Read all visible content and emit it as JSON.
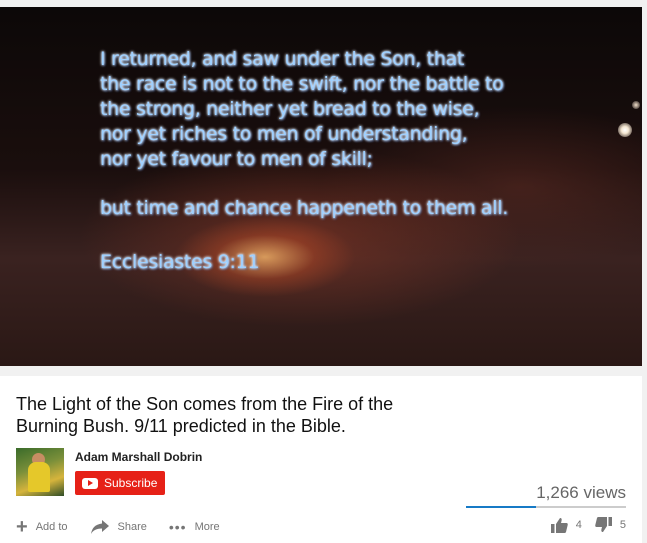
{
  "video": {
    "verse_lines": [
      "I returned, and saw under the Son, that",
      "the race is not to the swift, nor the battle to",
      "the strong, neither yet bread to the wise,",
      "nor yet riches to men of understanding,",
      "nor yet favour to men of skill;"
    ],
    "conclusion": "but time and chance happeneth to them all.",
    "reference": "Ecclesiastes 9:11"
  },
  "info": {
    "title": "The Light of the Son comes from the Fire of the Burning Bush. 9/11 predicted in the Bible.",
    "channel_name": "Adam Marshall Dobrin",
    "subscribe_label": "Subscribe",
    "views": "1,266 views",
    "like_ratio": 0.44
  },
  "actions": {
    "add_to": "Add to",
    "share": "Share",
    "more": "More",
    "like_count": "4",
    "dislike_count": "5"
  },
  "icons": [
    "plus-icon",
    "share-arrow-icon",
    "more-dots-icon",
    "thumbs-up-icon",
    "thumbs-down-icon",
    "youtube-play-icon"
  ],
  "colors": {
    "subscribe": "#e62117",
    "sentiment": "#167ac6",
    "verse_text": "#9fd0ff"
  }
}
